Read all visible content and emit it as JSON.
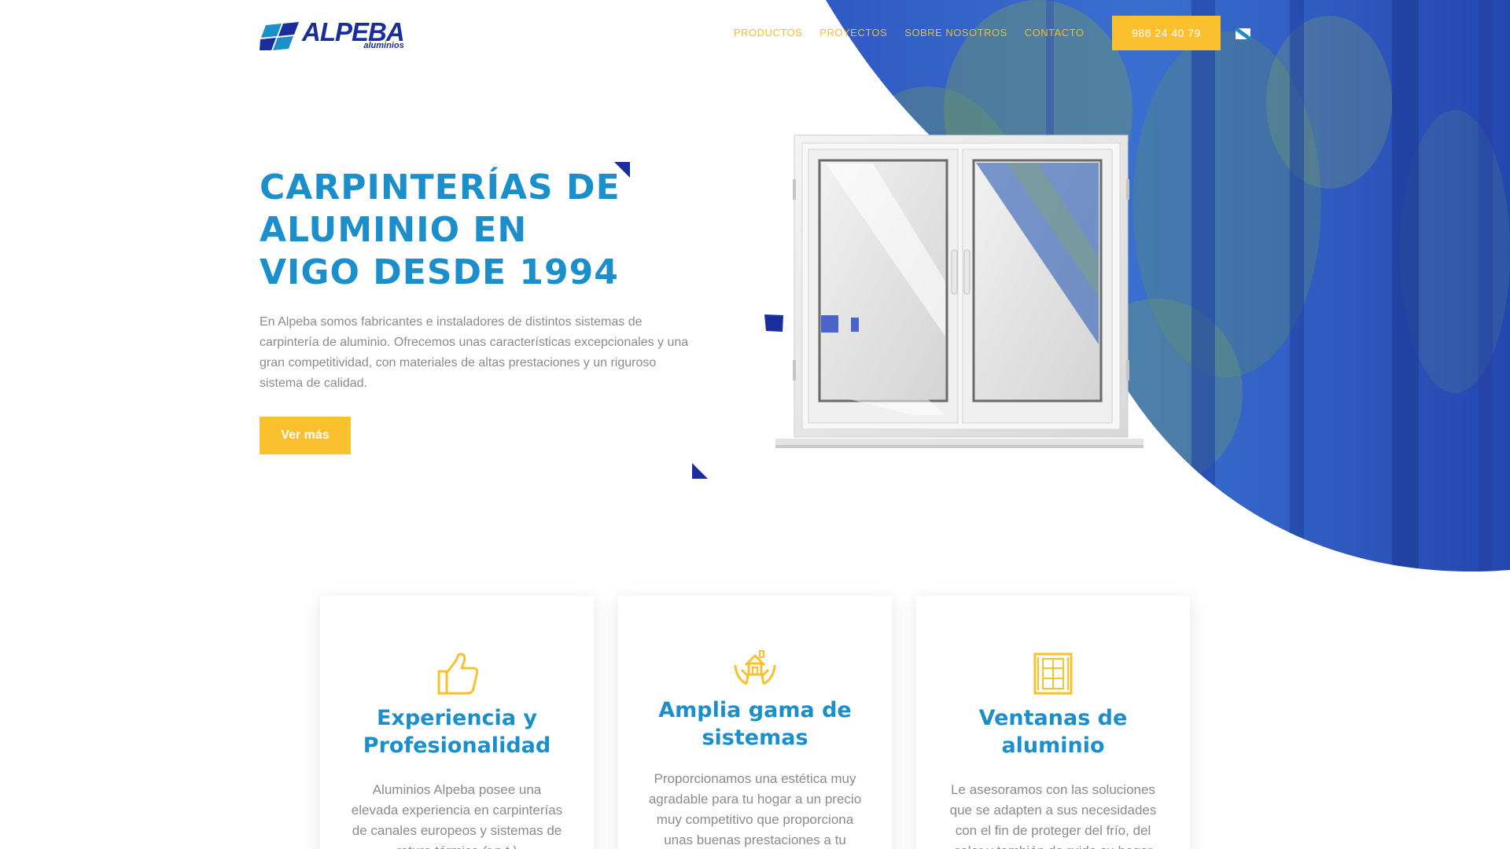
{
  "header": {
    "logo_text": "ALPEBA",
    "logo_sub": "aluminios",
    "nav": [
      "PRODUCTOS",
      "PROYECTOS",
      "SOBRE NOSOTROS",
      "CONTACTO"
    ],
    "phone": "986 24 40 79",
    "language_flag": "galician-flag-icon"
  },
  "hero": {
    "title": "CARPINTERÍAS DE ALUMINIO EN VIGO DESDE 1994",
    "text": "En Alpeba somos fabricantes e instaladores de distintos sistemas de carpintería de aluminio. Ofrecemos unas características excepcionales y una gran competitividad, con materiales de altas prestaciones y un riguroso sistema de calidad.",
    "button": "Ver más"
  },
  "features": [
    {
      "icon": "thumbs-up-icon",
      "title": "Experiencia y Profesionalidad",
      "text": "Aluminios Alpeba posee una elevada experiencia en carpinterías de canales europeos y sistemas de rotura térmica (r.p.t.)"
    },
    {
      "icon": "hands-house-icon",
      "title": "Amplia gama de sistemas",
      "text": "Proporcionamos una estética muy agradable para tu hogar a un precio muy competitivo que proporciona unas buenas prestaciones a tu"
    },
    {
      "icon": "window-icon",
      "title": "Ventanas de aluminio",
      "text": "Le asesoramos con las soluciones que se adapten a sus necesidades con el fin de proteger del frío, del calor y también de ruido su hogar"
    }
  ],
  "colors": {
    "primary_blue": "#1a8fcb",
    "dark_blue": "#1a2d9c",
    "accent_yellow": "#fbc02d",
    "body_gray": "#8b8b8b"
  }
}
